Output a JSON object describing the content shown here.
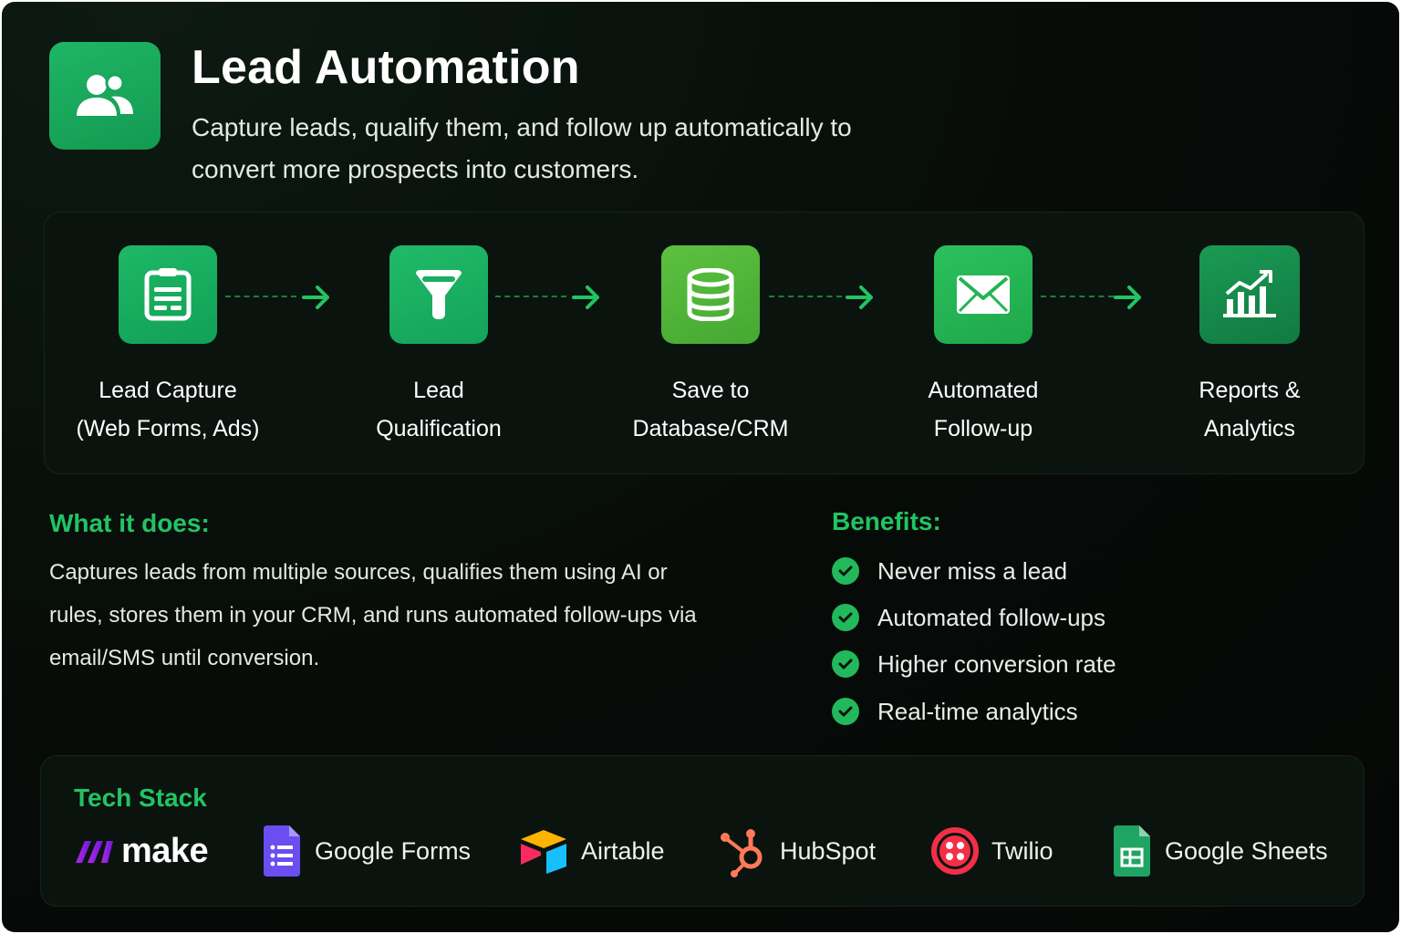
{
  "header": {
    "title": "Lead Automation",
    "subtitle": "Capture leads, qualify them, and follow up automatically to convert more prospects into customers.",
    "icon": "users-icon"
  },
  "flow": {
    "steps": [
      {
        "line1": "Lead Capture",
        "line2": "(Web Forms, Ads)",
        "icon": "form-icon",
        "color": "#17a85a"
      },
      {
        "line1": "Lead",
        "line2": "Qualification",
        "icon": "funnel-icon",
        "color": "#19ab5c"
      },
      {
        "line1": "Save to",
        "line2": "Database/CRM",
        "icon": "database-icon",
        "color": "#52b83c"
      },
      {
        "line1": "Automated",
        "line2": "Follow-up",
        "icon": "mail-icon",
        "color": "#25b354"
      },
      {
        "line1": "Reports &",
        "line2": "Analytics",
        "icon": "chart-icon",
        "color": "#158a4b"
      }
    ]
  },
  "what": {
    "heading": "What it does:",
    "text": "Captures leads from multiple sources, qualifies them using AI or rules, stores them in your CRM, and runs automated follow-ups via email/SMS until conversion."
  },
  "benefits": {
    "heading": "Benefits:",
    "items": [
      "Never miss a lead",
      "Automated follow-ups",
      "Higher conversion rate",
      "Real-time analytics"
    ]
  },
  "stack": {
    "heading": "Tech Stack",
    "tools": [
      {
        "name": "make",
        "icon": "make-logo"
      },
      {
        "name": "Google Forms",
        "icon": "google-forms-icon"
      },
      {
        "name": "Airtable",
        "icon": "airtable-icon"
      },
      {
        "name": "HubSpot",
        "icon": "hubspot-icon"
      },
      {
        "name": "Twilio",
        "icon": "twilio-icon"
      },
      {
        "name": "Google Sheets",
        "icon": "google-sheets-icon"
      }
    ]
  },
  "colors": {
    "accent": "#22c463",
    "background": "#070b08",
    "panel": "#0b130e"
  }
}
